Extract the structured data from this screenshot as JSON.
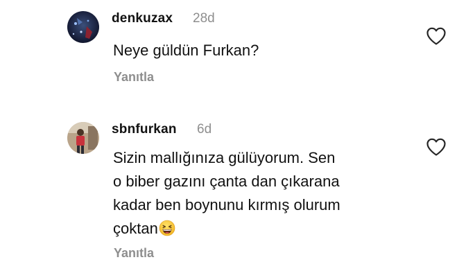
{
  "comments": [
    {
      "username": "denkuzax",
      "time": "28d",
      "lines": [
        "Neye güldün Furkan?"
      ],
      "reply_label": "Yanıtla",
      "like_icon": "heart-outline-icon"
    },
    {
      "username": "sbnfurkan",
      "time": "6d",
      "lines": [
        "Sizin mallığınıza gülüyorum. Sen",
        "o biber gazını çanta dan çıkarana",
        "kadar ben boynunu kırmış olurum",
        "çoktan"
      ],
      "emoji": "grinning-squinting-face-emoji",
      "reply_label": "Yanıtla",
      "like_icon": "heart-outline-icon"
    }
  ],
  "colors": {
    "text": "#111111",
    "secondary": "#8e8e8e",
    "background": "#ffffff"
  }
}
